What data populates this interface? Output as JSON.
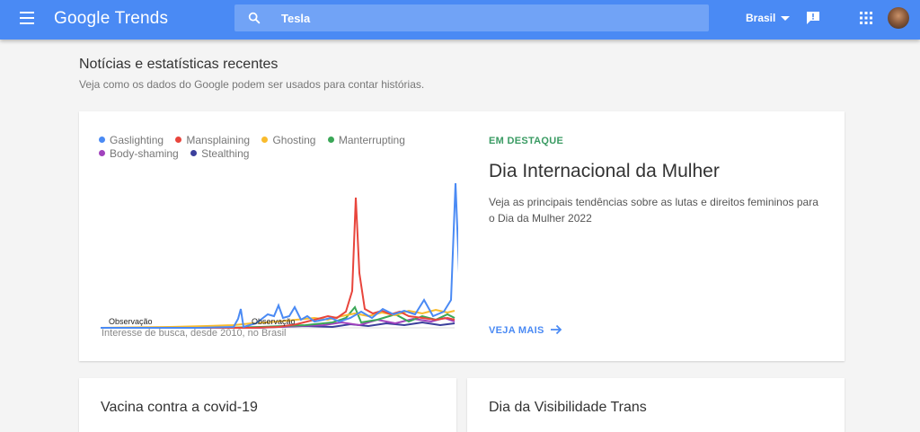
{
  "header": {
    "logo_text": "Google Trends",
    "search": {
      "value": "Tesla"
    },
    "region": "Brasil",
    "brand_color": "#4a8af4"
  },
  "intro": {
    "title": "Notícias e estatísticas recentes",
    "subtitle": "Veja como os dados do Google podem ser usados para contar histórias."
  },
  "featured": {
    "legend": [
      {
        "label": "Gaslighting",
        "color": "#4a8af4"
      },
      {
        "label": "Mansplaining",
        "color": "#e8453c"
      },
      {
        "label": "Ghosting",
        "color": "#f9bb2d"
      },
      {
        "label": "Manterrupting",
        "color": "#3aa757"
      },
      {
        "label": "Body-shaming",
        "color": "#a142bd"
      },
      {
        "label": "Stealthing",
        "color": "#3b3f9c"
      }
    ],
    "annotation_1": "Observação",
    "annotation_2": "Observação",
    "chart_caption": "Interesse de busca, desde 2010, no Brasil",
    "label": "EM DESTAQUE",
    "title": "Dia Internacional da Mulher",
    "description": "Veja as principais tendências sobre as lutas e direitos femininos para o Dia da Mulher 2022",
    "see_more": "VEJA MAIS"
  },
  "cards": [
    {
      "title": "Vacina contra a covid-19"
    },
    {
      "title": "Dia da Visibilidade Trans"
    }
  ]
}
